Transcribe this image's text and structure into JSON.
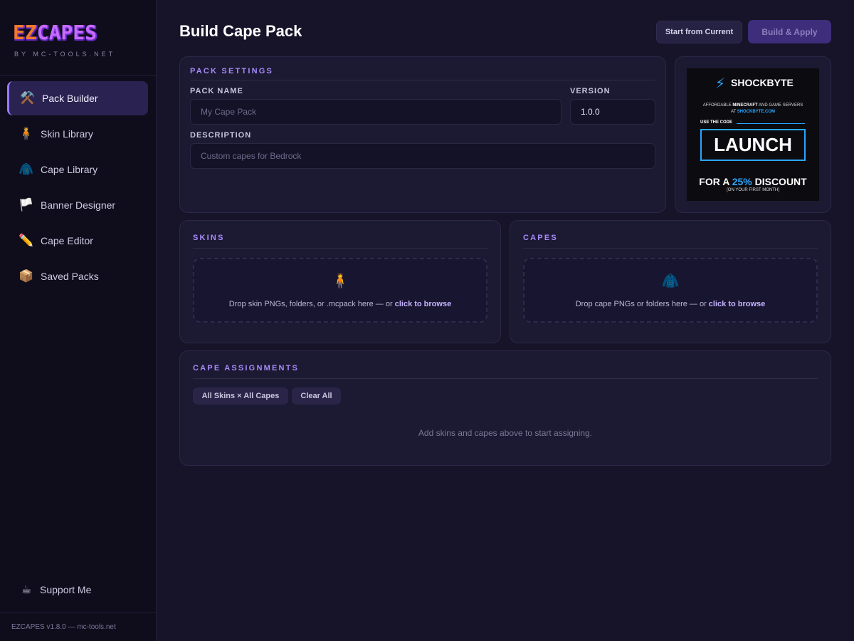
{
  "app": {
    "logo_part1": "EZ",
    "logo_part2": "CAPES",
    "logo_subtitle": "BY MC-TOOLS.NET",
    "version_footer": "EZCAPES v1.8.0 — mc-tools.net"
  },
  "sidebar": {
    "items": [
      {
        "label": "Pack Builder",
        "icon": "⚒️",
        "icon_name": "hammer-pick-icon",
        "active": true
      },
      {
        "label": "Skin Library",
        "icon": "🧍",
        "icon_name": "person-icon",
        "active": false
      },
      {
        "label": "Cape Library",
        "icon": "🧥",
        "icon_name": "coat-icon",
        "active": false
      },
      {
        "label": "Banner Designer",
        "icon": "🏳️",
        "icon_name": "white-flag-icon",
        "active": false
      },
      {
        "label": "Cape Editor",
        "icon": "✏️",
        "icon_name": "pencil-icon",
        "active": false
      },
      {
        "label": "Saved Packs",
        "icon": "📦",
        "icon_name": "package-icon",
        "active": false
      }
    ],
    "support": {
      "label": "Support Me",
      "icon": "☕",
      "icon_name": "coffee-icon"
    }
  },
  "header": {
    "title": "Build Cape Pack",
    "start_label": "Start from Current",
    "build_label": "Build & Apply"
  },
  "pack_settings": {
    "title": "PACK SETTINGS",
    "name_label": "PACK NAME",
    "name_placeholder": "My Cape Pack",
    "version_label": "VERSION",
    "version_value": "1.0.0",
    "description_label": "DESCRIPTION",
    "description_placeholder": "Custom capes for Bedrock"
  },
  "ad": {
    "brand": "SHOCKBYTE",
    "tagline_pre": "AFFORDABLE ",
    "tagline_bold": "MINECRAFT",
    "tagline_post": " AND GAME SERVERS",
    "at": "AT ",
    "url": "SHOCKBYTE.COM",
    "use_code": "USE THE CODE",
    "code": "LAUNCH",
    "discount_pre": "FOR A ",
    "discount_pct": "25%",
    "discount_post": " DISCOUNT",
    "first_month": "[ON YOUR FIRST MONTH]"
  },
  "skins": {
    "title": "SKINS",
    "icon": "🧍",
    "drop_text": "Drop skin PNGs, folders, or .mcpack here — or ",
    "browse": "click to browse"
  },
  "capes": {
    "title": "CAPES",
    "icon": "🧥",
    "drop_text": "Drop cape PNGs or folders here — or ",
    "browse": "click to browse"
  },
  "assignments": {
    "title": "CAPE ASSIGNMENTS",
    "all_label": "All Skins × All Capes",
    "clear_label": "Clear All",
    "empty": "Add skins and capes above to start assigning."
  },
  "colors": {
    "accent": "#a78bfa",
    "ad_blue": "#2aa6ff",
    "logo_orange": "#f07a2a"
  }
}
